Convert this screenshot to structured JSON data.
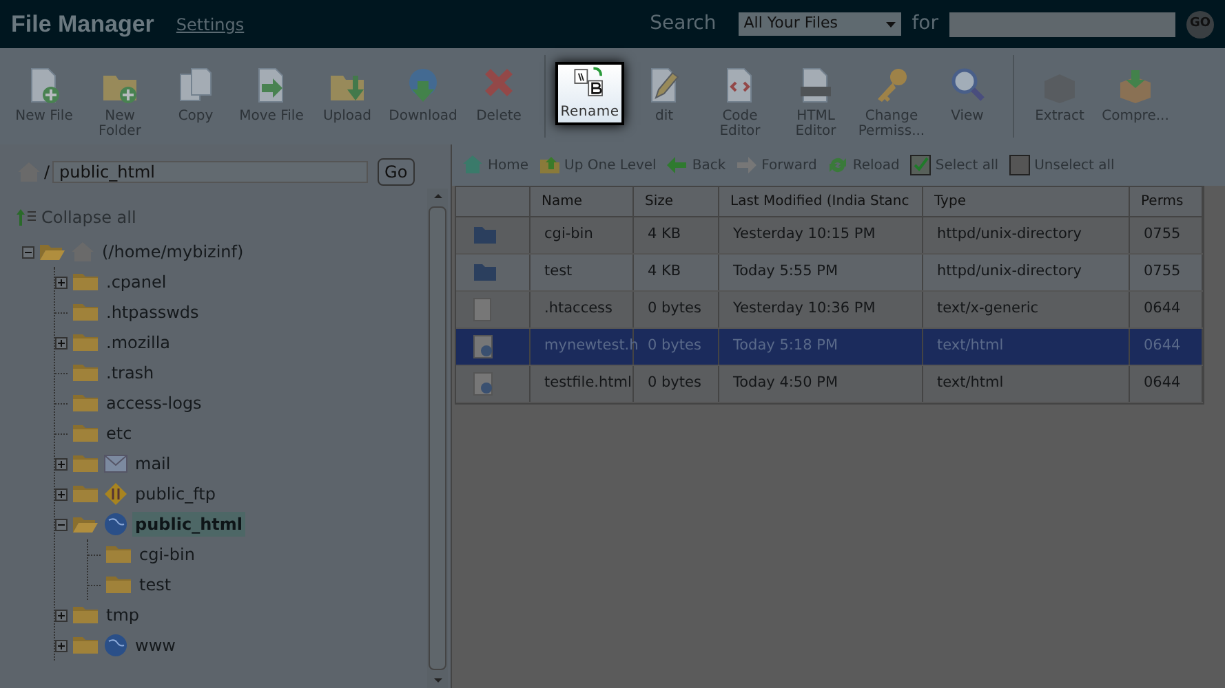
{
  "header": {
    "title": "File Manager",
    "settings_link": "Settings",
    "search_label": "Search",
    "search_scope": "All Your Files",
    "for_label": "for",
    "go_button": "GO"
  },
  "toolbar": [
    {
      "label": "New File",
      "kind": "new-file",
      "spotlight": false,
      "separator_before": false
    },
    {
      "label": "New Folder",
      "kind": "new-folder",
      "spotlight": false,
      "separator_before": false
    },
    {
      "label": "Copy",
      "kind": "copy",
      "spotlight": false,
      "separator_before": false
    },
    {
      "label": "Move File",
      "kind": "move",
      "spotlight": false,
      "separator_before": false
    },
    {
      "label": "Upload",
      "kind": "upload",
      "spotlight": false,
      "separator_before": false
    },
    {
      "label": "Download",
      "kind": "download",
      "spotlight": false,
      "separator_before": false
    },
    {
      "label": "Delete",
      "kind": "delete",
      "spotlight": false,
      "separator_before": false
    },
    {
      "label": "Rename",
      "kind": "rename",
      "spotlight": true,
      "separator_before": true
    },
    {
      "label": "dit",
      "kind": "edit",
      "spotlight": false,
      "separator_before": false
    },
    {
      "label": "Code Editor",
      "kind": "code",
      "spotlight": false,
      "separator_before": false
    },
    {
      "label": "HTML Editor",
      "kind": "html",
      "spotlight": false,
      "separator_before": false
    },
    {
      "label": "Change Permiss...",
      "kind": "key",
      "spotlight": false,
      "separator_before": false
    },
    {
      "label": "View",
      "kind": "view",
      "spotlight": false,
      "separator_before": false
    },
    {
      "label": "Extract",
      "kind": "extract",
      "spotlight": false,
      "separator_before": true
    },
    {
      "label": "Compre...",
      "kind": "compress",
      "spotlight": false,
      "separator_before": false
    }
  ],
  "path_bar": {
    "prefix": "/",
    "value": "public_html",
    "go_button": "Go"
  },
  "collapse_all": "Collapse all",
  "tree": [
    {
      "name": "(/home/mybizinf)",
      "kind": "home",
      "has_children": true,
      "expanded": true,
      "selected": false,
      "children": [
        {
          "name": ".cpanel",
          "kind": "folder",
          "has_children": true,
          "expanded": false,
          "selected": false
        },
        {
          "name": ".htpasswds",
          "kind": "folder",
          "has_children": false,
          "expanded": false,
          "selected": false
        },
        {
          "name": ".mozilla",
          "kind": "folder",
          "has_children": true,
          "expanded": false,
          "selected": false
        },
        {
          "name": ".trash",
          "kind": "folder",
          "has_children": false,
          "expanded": false,
          "selected": false
        },
        {
          "name": "access-logs",
          "kind": "folder",
          "has_children": false,
          "expanded": false,
          "selected": false
        },
        {
          "name": "etc",
          "kind": "folder",
          "has_children": false,
          "expanded": false,
          "selected": false
        },
        {
          "name": "mail",
          "kind": "mail",
          "has_children": true,
          "expanded": false,
          "selected": false
        },
        {
          "name": "public_ftp",
          "kind": "ftp",
          "has_children": true,
          "expanded": false,
          "selected": false
        },
        {
          "name": "public_html",
          "kind": "web",
          "has_children": true,
          "expanded": true,
          "selected": true,
          "children": [
            {
              "name": "cgi-bin",
              "kind": "folder",
              "has_children": false,
              "expanded": false,
              "selected": false
            },
            {
              "name": "test",
              "kind": "folder",
              "has_children": false,
              "expanded": false,
              "selected": false
            }
          ]
        },
        {
          "name": "tmp",
          "kind": "folder",
          "has_children": true,
          "expanded": false,
          "selected": false
        },
        {
          "name": "www",
          "kind": "web",
          "has_children": true,
          "expanded": false,
          "selected": false
        }
      ]
    }
  ],
  "nav": [
    {
      "label": "Home",
      "kind": "home"
    },
    {
      "label": "Up One Level",
      "kind": "up"
    },
    {
      "label": "Back",
      "kind": "back"
    },
    {
      "label": "Forward",
      "kind": "forward"
    },
    {
      "label": "Reload",
      "kind": "reload"
    },
    {
      "label": "Select all",
      "kind": "check"
    },
    {
      "label": "Unselect all",
      "kind": "uncheck"
    }
  ],
  "table": {
    "columns": [
      "Name",
      "Size",
      "Last Modified (India Stanc",
      "Type",
      "Perms"
    ],
    "rows": [
      {
        "kind": "folder",
        "selected": false,
        "cells": [
          "cgi-bin",
          "4 KB",
          "Yesterday 10:15 PM",
          "httpd/unix-directory",
          "0755"
        ]
      },
      {
        "kind": "folder",
        "selected": false,
        "cells": [
          "test",
          "4 KB",
          "Today 5:55 PM",
          "httpd/unix-directory",
          "0755"
        ]
      },
      {
        "kind": "text",
        "selected": false,
        "cells": [
          ".htaccess",
          "0 bytes",
          "Yesterday 10:36 PM",
          "text/x-generic",
          "0644"
        ]
      },
      {
        "kind": "html",
        "selected": true,
        "cells": [
          "mynewtest.h",
          "0 bytes",
          "Today 5:18 PM",
          "text/html",
          "0644"
        ]
      },
      {
        "kind": "html",
        "selected": false,
        "cells": [
          "testfile.html",
          "0 bytes",
          "Today 4:50 PM",
          "text/html",
          "0644"
        ]
      }
    ]
  }
}
